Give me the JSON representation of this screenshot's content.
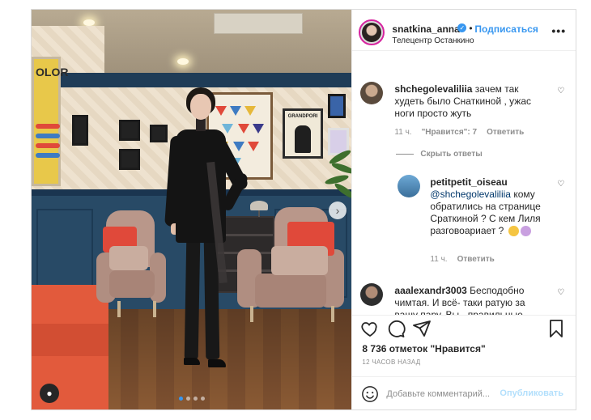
{
  "post": {
    "header": {
      "username": "snatkina_anna",
      "separator": "•",
      "follow_label": "Подписаться",
      "location": "Телецентр Останкино",
      "more_label": "•••"
    },
    "image": {
      "poster_words": [
        "OLOR",
        "GRANDPORI"
      ],
      "dots": 4,
      "active_dot": 1
    },
    "comments": [
      {
        "username": "shchegolevaliliia",
        "text": "зачем так худеть было Снаткиной , ужас ноги просто жуть",
        "time": "11 ч.",
        "likes_label": "\"Нравится\": 7",
        "reply_label": "Ответить"
      }
    ],
    "hide_replies_label": "Скрыть ответы",
    "replies": [
      {
        "username": "petitpetit_oiseau",
        "mention": "@shchegolevaliliia",
        "text": "кому обратились на странице Сраткиной ? С кем Лиля разговоариает ?",
        "time": "11 ч.",
        "reply_label": "Ответить"
      }
    ],
    "comment3": {
      "username": "aaalexandr3003",
      "text": "Бесподобно чимтая. И всё- таки ратую за вашу пару. Вы - правильные"
    },
    "likes": "8 736 отметок \"Нравится\"",
    "time_ago": "12 ЧАСОВ НАЗАД",
    "add_comment": {
      "placeholder": "Добавьте комментарий...",
      "publish_label": "Опубликовать"
    }
  },
  "colors": {
    "accent": "#3897f0",
    "publish_disabled": "#b2dffc",
    "muted": "#8e8e8e",
    "text": "#262626",
    "border": "#dbdbdb"
  }
}
